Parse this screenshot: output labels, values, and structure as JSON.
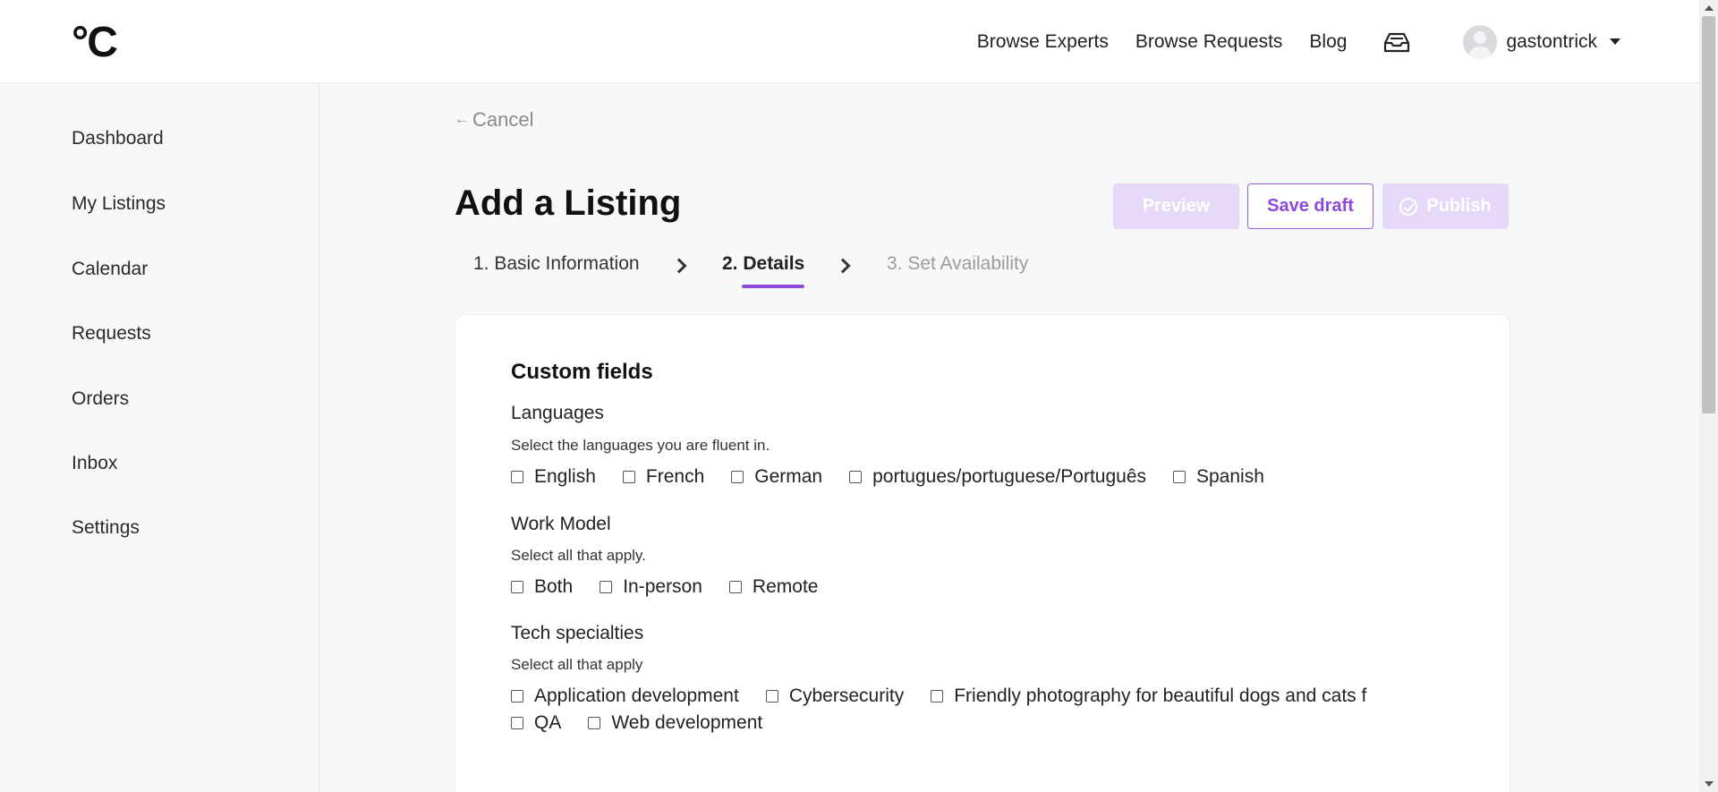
{
  "header": {
    "logo": "°C",
    "nav": [
      "Browse Experts",
      "Browse Requests",
      "Blog"
    ],
    "inbox_icon": "inbox-tray-icon",
    "username": "gastontrick"
  },
  "sidebar": {
    "items": [
      "Dashboard",
      "My Listings",
      "Calendar",
      "Requests",
      "Orders",
      "Inbox",
      "Settings"
    ]
  },
  "main": {
    "cancel": "Cancel",
    "title": "Add a Listing",
    "buttons": {
      "preview": "Preview",
      "save": "Save draft",
      "publish": "Publish"
    },
    "steps": [
      "1. Basic Information",
      "2. Details",
      "3. Set Availability"
    ],
    "active_step": 2
  },
  "form": {
    "section_title": "Custom fields",
    "fields": [
      {
        "label": "Languages",
        "help": "Select the languages you are fluent in.",
        "options": [
          "English",
          "French",
          "German",
          "portugues/portuguese/Português",
          "Spanish"
        ]
      },
      {
        "label": "Work Model",
        "help": "Select all that apply.",
        "options": [
          "Both",
          "In-person",
          "Remote"
        ]
      },
      {
        "label": "Tech specialties",
        "help": "Select all that apply",
        "options": [
          "Application development",
          "Cybersecurity",
          "Friendly photography for beautiful dogs and cats f",
          "QA",
          "Web development"
        ]
      }
    ]
  },
  "colors": {
    "accent": "#8f4de0",
    "disabled_button": "#e5d8f8",
    "page_bg": "#f7f8fa"
  }
}
